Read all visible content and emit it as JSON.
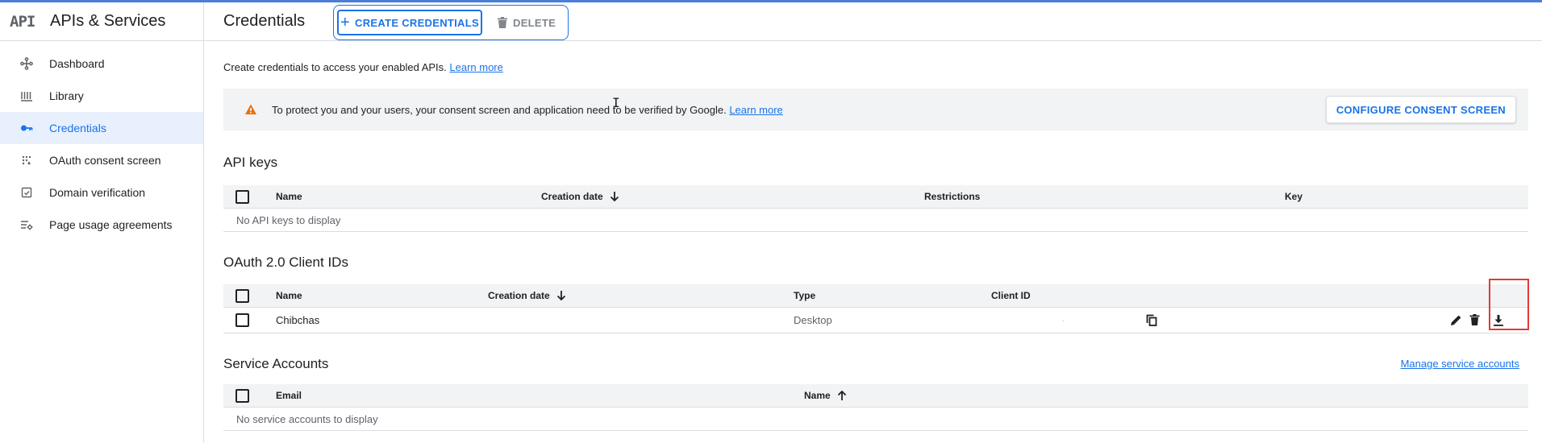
{
  "app": {
    "logo_text": "API",
    "title": "APIs & Services"
  },
  "sidebar": {
    "items": [
      {
        "label": "Dashboard",
        "icon": "dashboard-icon"
      },
      {
        "label": "Library",
        "icon": "library-icon"
      },
      {
        "label": "Credentials",
        "icon": "key-icon",
        "active": true
      },
      {
        "label": "OAuth consent screen",
        "icon": "consent-icon"
      },
      {
        "label": "Domain verification",
        "icon": "domain-check-icon"
      },
      {
        "label": "Page usage agreements",
        "icon": "settings-list-icon"
      }
    ]
  },
  "header": {
    "title": "Credentials",
    "create_label": "CREATE CREDENTIALS",
    "delete_label": "DELETE"
  },
  "intro": {
    "text": "Create credentials to access your enabled APIs.",
    "link": "Learn more"
  },
  "banner": {
    "text": "To protect you and your users, your consent screen and application need to be verified by Google.",
    "link": "Learn more",
    "button": "CONFIGURE CONSENT SCREEN"
  },
  "api_keys": {
    "title": "API keys",
    "columns": [
      "Name",
      "Creation date",
      "Restrictions",
      "Key"
    ],
    "empty": "No API keys to display"
  },
  "oauth": {
    "title": "OAuth 2.0 Client IDs",
    "columns": [
      "Name",
      "Creation date",
      "Type",
      "Client ID"
    ],
    "rows": [
      {
        "name": "Chibchas",
        "creation_date": "",
        "type": "Desktop",
        "client_id": "-"
      }
    ]
  },
  "service_accounts": {
    "title": "Service Accounts",
    "manage_link": "Manage service accounts",
    "columns": [
      "Email",
      "Name"
    ],
    "empty": "No service accounts to display"
  },
  "colors": {
    "accent": "#1a73e8",
    "warning": "#e8710a",
    "highlight": "#e53935"
  }
}
